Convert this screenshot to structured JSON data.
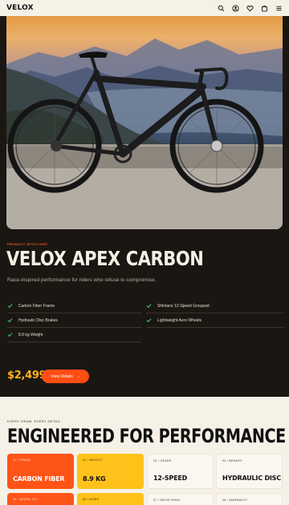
{
  "header": {
    "logo": "VELOX",
    "icons": [
      "search-icon",
      "user-icon",
      "heart-icon",
      "cart-icon",
      "menu-icon"
    ]
  },
  "hero": {
    "eyebrow": "PRODUCT SPOTLIGHT",
    "title": "VELOX APEX CARBON",
    "description": "Race-inspired performance for riders who refuse to compromise.",
    "features": [
      "Carbon Fiber Frame",
      "Shimano 12-Speed Groupset",
      "Hydraulic Disc Brakes",
      "Lightweight Aero Wheels",
      "8.9 kg Weight"
    ],
    "price": "$2,499",
    "cta_label": "View Details",
    "cta_arrow": "→"
  },
  "specs": {
    "eyebrow": "EVERY GRAM. EVERY DETAIL.",
    "title": "ENGINEERED FOR PERFORMANCE",
    "cards": [
      {
        "label": "01 / FRAME",
        "value": "CARBON FIBER"
      },
      {
        "label": "02 / WEIGHT",
        "value": "8.9 KG"
      },
      {
        "label": "03 / GEARS",
        "value": "12-SPEED"
      },
      {
        "label": "04 / BRAKES",
        "value": "HYDRAULIC DISC"
      },
      {
        "label": "05 / WHEEL SET",
        "value": ""
      },
      {
        "label": "06 / MORE",
        "value": ""
      },
      {
        "label": "07 / DRIVETRAIN",
        "value": ""
      },
      {
        "label": "08 / WARRANTY",
        "value": ""
      }
    ]
  },
  "colors": {
    "accent_orange": "#ff4d14",
    "accent_yellow": "#ffc21a",
    "hero_background": "#1a1612",
    "page_background": "#f6f1e7"
  }
}
